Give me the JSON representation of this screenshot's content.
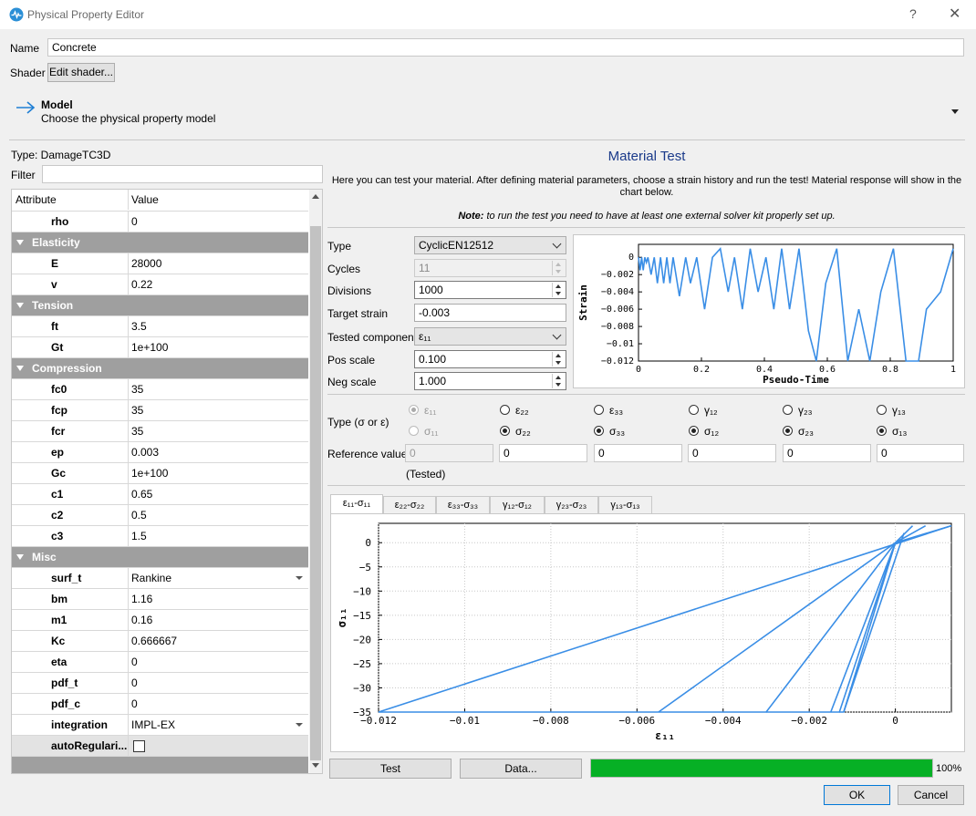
{
  "window": {
    "title": "Physical Property Editor",
    "help": "?",
    "close": "✕"
  },
  "header": {
    "name_label": "Name",
    "name_value": "Concrete",
    "shader_label": "Shader",
    "shader_button": "Edit shader..."
  },
  "model": {
    "title": "Model",
    "subtitle": "Choose the physical property model"
  },
  "left": {
    "type_text": "Type:  DamageTC3D",
    "filter_label": "Filter",
    "filter_value": "",
    "col_attribute": "Attribute",
    "col_value": "Value",
    "rows": [
      {
        "kind": "row",
        "name": "rho",
        "value": "0"
      },
      {
        "kind": "group",
        "name": "Elasticity"
      },
      {
        "kind": "row",
        "name": "E",
        "value": "28000"
      },
      {
        "kind": "row",
        "name": "v",
        "value": "0.22"
      },
      {
        "kind": "group",
        "name": "Tension"
      },
      {
        "kind": "row",
        "name": "ft",
        "value": "3.5"
      },
      {
        "kind": "row",
        "name": "Gt",
        "value": "1e+100"
      },
      {
        "kind": "group",
        "name": "Compression"
      },
      {
        "kind": "row",
        "name": "fc0",
        "value": "35"
      },
      {
        "kind": "row",
        "name": "fcp",
        "value": "35"
      },
      {
        "kind": "row",
        "name": "fcr",
        "value": "35"
      },
      {
        "kind": "row",
        "name": "ep",
        "value": "0.003"
      },
      {
        "kind": "row",
        "name": "Gc",
        "value": "1e+100"
      },
      {
        "kind": "row",
        "name": "c1",
        "value": "0.65"
      },
      {
        "kind": "row",
        "name": "c2",
        "value": "0.5"
      },
      {
        "kind": "row",
        "name": "c3",
        "value": "1.5"
      },
      {
        "kind": "group",
        "name": "Misc"
      },
      {
        "kind": "row",
        "name": "surf_t",
        "value": "Rankine",
        "dropdown": true
      },
      {
        "kind": "row",
        "name": "bm",
        "value": "1.16"
      },
      {
        "kind": "row",
        "name": "m1",
        "value": "0.16"
      },
      {
        "kind": "row",
        "name": "Kc",
        "value": "0.666667"
      },
      {
        "kind": "row",
        "name": "eta",
        "value": "0"
      },
      {
        "kind": "row",
        "name": "pdf_t",
        "value": "0"
      },
      {
        "kind": "row",
        "name": "pdf_c",
        "value": "0"
      },
      {
        "kind": "row",
        "name": "integration",
        "value": "IMPL-EX",
        "dropdown": true
      },
      {
        "kind": "row",
        "name": "autoRegulari...",
        "value": "",
        "checkbox": true
      }
    ]
  },
  "material_test": {
    "title": "Material Test",
    "description": "Here you can test your material. After defining material parameters, choose a strain history and run the test! Material response will show in the chart below.",
    "note_bold": "Note:",
    "note_text": " to run the test you need to have at least one external solver kit properly set up.",
    "type_label": "Type",
    "type_value": "CyclicEN12512",
    "cycles_label": "Cycles",
    "cycles_value": "11",
    "divisions_label": "Divisions",
    "divisions_value": "1000",
    "target_label": "Target strain",
    "target_value": "-0.003",
    "component_label": "Tested component",
    "component_value": "ε₁₁",
    "pos_label": "Pos scale",
    "pos_value": "0.100",
    "neg_label": "Neg scale",
    "neg_value": "1.000",
    "type_sigma_label": "Type (σ or ε)",
    "eps_labels": [
      "ε₁₁",
      "ε₂₂",
      "ε₃₃",
      "γ₁₂",
      "γ₂₃",
      "γ₁₃"
    ],
    "sig_labels": [
      "σ₁₁",
      "σ₂₂",
      "σ₃₃",
      "σ₁₂",
      "σ₂₃",
      "σ₁₃"
    ],
    "ref_label": "Reference value",
    "ref_values": [
      "0",
      "0",
      "0",
      "0",
      "0",
      "0"
    ],
    "tested_label": "(Tested)",
    "tabs": [
      "ε₁₁-σ₁₁",
      "ε₂₂-σ₂₂",
      "ε₃₃-σ₃₃",
      "γ₁₂-σ₁₂",
      "γ₂₃-σ₂₃",
      "γ₁₃-σ₁₃"
    ],
    "test_button": "Test",
    "data_button": "Data...",
    "progress": 100,
    "progress_text": "100%",
    "ok": "OK",
    "cancel": "Cancel"
  },
  "chart_data": [
    {
      "type": "line",
      "xlabel": "Pseudo-Time",
      "ylabel": "Strain",
      "xlim": [
        0,
        1
      ],
      "ylim": [
        -0.012,
        0.0015
      ],
      "xticks": [
        "0",
        "0.2",
        "0.4",
        "0.6",
        "0.8",
        "1"
      ],
      "yticks": [
        "0",
        "−0.002",
        "−0.004",
        "−0.006",
        "−0.008",
        "−0.01",
        "−0.012"
      ],
      "color": "#3a8ee6",
      "x": [
        0,
        0.005,
        0.01,
        0.015,
        0.02,
        0.025,
        0.03,
        0.04,
        0.05,
        0.06,
        0.07,
        0.08,
        0.09,
        0.1,
        0.11,
        0.13,
        0.15,
        0.165,
        0.185,
        0.21,
        0.235,
        0.26,
        0.285,
        0.305,
        0.33,
        0.355,
        0.38,
        0.405,
        0.43,
        0.455,
        0.48,
        0.51,
        0.54,
        0.565,
        0.595,
        0.63,
        0.665,
        0.7,
        0.735,
        0.77,
        0.81,
        0.85,
        0.89,
        0.915,
        0.96,
        1.0
      ],
      "y": [
        0,
        -0.0015,
        0,
        -0.0015,
        0,
        -0.0006,
        0,
        -0.002,
        0,
        -0.003,
        0,
        -0.003,
        0,
        -0.003,
        0,
        -0.0045,
        0,
        -0.003,
        0,
        -0.006,
        0,
        0.001,
        -0.004,
        0,
        -0.006,
        0.001,
        -0.004,
        0,
        -0.006,
        0.001,
        -0.006,
        0.001,
        -0.0085,
        -0.012,
        -0.003,
        0.001,
        -0.012,
        -0.006,
        -0.012,
        -0.004,
        0.001,
        -0.012,
        -0.012,
        -0.006,
        -0.004,
        0.001
      ]
    },
    {
      "type": "line",
      "xlabel": "ε₁₁",
      "ylabel": "σ₁₁",
      "xlim": [
        -0.012,
        0.0013
      ],
      "ylim": [
        -35,
        4
      ],
      "xticks": [
        "−0.012",
        "−0.01",
        "−0.008",
        "−0.006",
        "−0.004",
        "−0.002",
        "0"
      ],
      "yticks": [
        "0",
        "−5",
        "−10",
        "−15",
        "−20",
        "−25",
        "−30",
        "−35"
      ],
      "color": "#3a8ee6"
    }
  ]
}
